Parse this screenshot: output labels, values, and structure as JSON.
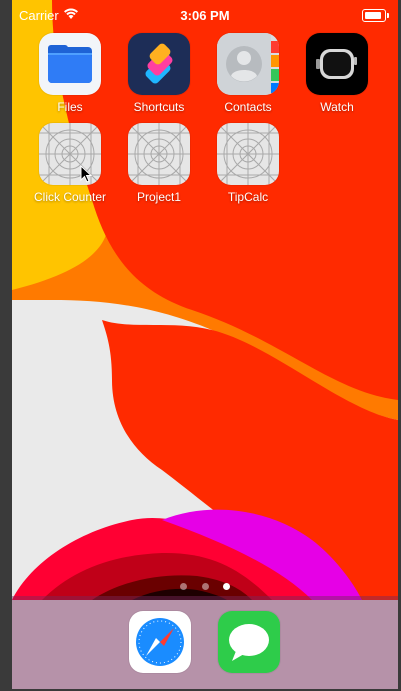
{
  "status": {
    "carrier": "Carrier",
    "time": "3:06 PM",
    "battery_percent": 90
  },
  "apps": [
    {
      "label": "Files",
      "icon": "files-icon"
    },
    {
      "label": "Shortcuts",
      "icon": "shortcuts-icon"
    },
    {
      "label": "Contacts",
      "icon": "contacts-icon"
    },
    {
      "label": "Watch",
      "icon": "watch-icon"
    },
    {
      "label": "Click Counter",
      "icon": "app-placeholder-icon"
    },
    {
      "label": "Project1",
      "icon": "app-placeholder-icon"
    },
    {
      "label": "TipCalc",
      "icon": "app-placeholder-icon"
    }
  ],
  "page_indicator": {
    "pages": 3,
    "current_page": 3
  },
  "dock": [
    {
      "icon": "safari-icon"
    },
    {
      "icon": "messages-icon"
    }
  ],
  "colors": {
    "wallpaper_red": "#ff2a00",
    "wallpaper_orange": "#ff7a00",
    "wallpaper_yellow": "#ffc400",
    "wallpaper_magenta": "#e600e6",
    "files_blue": "#2f7cf6",
    "messages_green": "#2ecc4a"
  }
}
